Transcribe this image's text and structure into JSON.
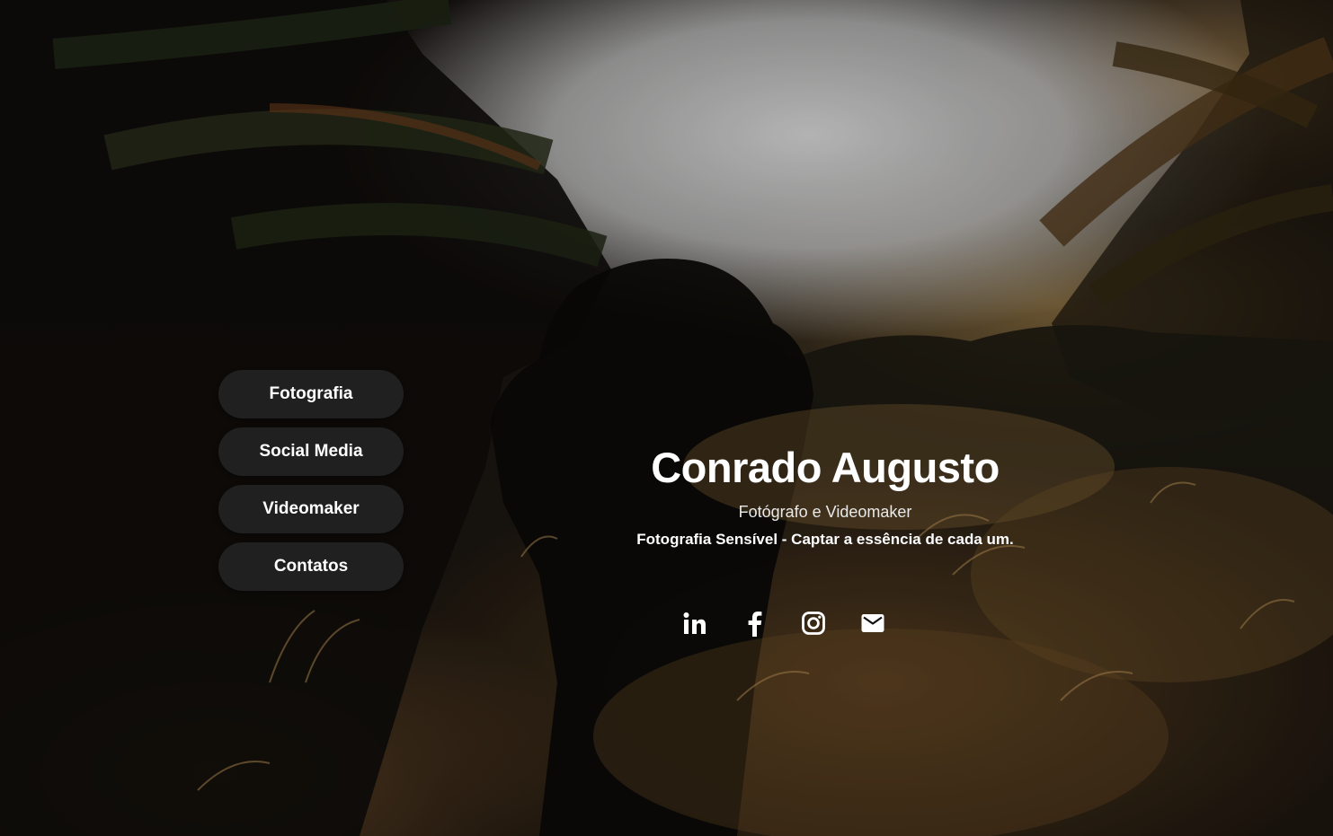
{
  "menu": {
    "items": [
      {
        "label": "Fotografia"
      },
      {
        "label": "Social Media"
      },
      {
        "label": "Videomaker"
      },
      {
        "label": "Contatos"
      }
    ]
  },
  "hero": {
    "name": "Conrado Augusto",
    "role": "Fotógrafo e Videomaker",
    "tagline": "Fotografia Sensível - Captar a essência de cada um."
  },
  "social": {
    "icons": [
      "linkedin-icon",
      "facebook-icon",
      "instagram-icon",
      "email-icon"
    ]
  },
  "colors": {
    "button_bg": "#202020",
    "text": "#ffffff"
  }
}
